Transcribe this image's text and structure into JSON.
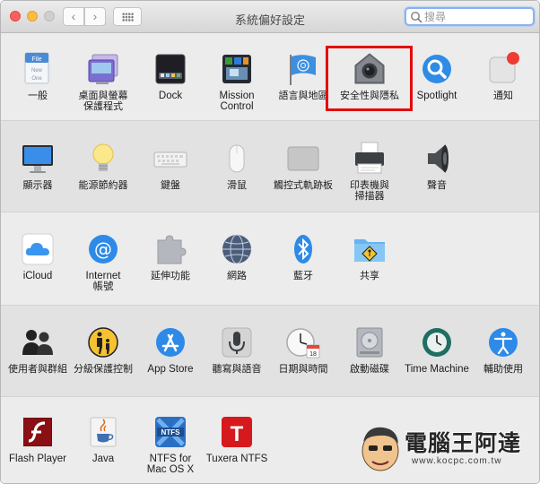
{
  "window": {
    "title": "系統偏好設定"
  },
  "search": {
    "placeholder": "搜尋",
    "value": ""
  },
  "sections": [
    {
      "items": [
        {
          "label": "一般",
          "icon": "general-file-icon"
        },
        {
          "label": "桌面與螢幕\n保護程式",
          "icon": "desktop-screensaver-icon"
        },
        {
          "label": "Dock",
          "icon": "dock-icon"
        },
        {
          "label": "Mission\nControl",
          "icon": "mission-control-icon"
        },
        {
          "label": "語言與地區",
          "icon": "un-flag-icon"
        },
        {
          "label": "安全性與隱私",
          "icon": "security-house-icon"
        },
        {
          "label": "Spotlight",
          "icon": "spotlight-magnifier-icon"
        },
        {
          "label": "通知",
          "icon": "notifications-icon"
        }
      ]
    },
    {
      "items": [
        {
          "label": "顯示器",
          "icon": "display-icon"
        },
        {
          "label": "能源節約器",
          "icon": "lightbulb-icon"
        },
        {
          "label": "鍵盤",
          "icon": "keyboard-icon"
        },
        {
          "label": "滑鼠",
          "icon": "mouse-icon"
        },
        {
          "label": "觸控式軌跡板",
          "icon": "trackpad-icon"
        },
        {
          "label": "印表機與\n掃描器",
          "icon": "printer-icon"
        },
        {
          "label": "聲音",
          "icon": "speaker-icon"
        }
      ]
    },
    {
      "items": [
        {
          "label": "iCloud",
          "icon": "icloud-icon"
        },
        {
          "label": "Internet\n帳號",
          "icon": "internet-accounts-at-icon"
        },
        {
          "label": "延伸功能",
          "icon": "extensions-puzzle-icon"
        },
        {
          "label": "網路",
          "icon": "network-globe-icon"
        },
        {
          "label": "藍牙",
          "icon": "bluetooth-icon"
        },
        {
          "label": "共享",
          "icon": "sharing-folder-icon"
        }
      ]
    },
    {
      "items": [
        {
          "label": "使用者與群組",
          "icon": "users-groups-icon"
        },
        {
          "label": "分級保護控制",
          "icon": "parental-controls-icon"
        },
        {
          "label": "App Store",
          "icon": "app-store-icon"
        },
        {
          "label": "聽寫與語音",
          "icon": "microphone-icon"
        },
        {
          "label": "日期與時間",
          "icon": "clock-calendar-icon"
        },
        {
          "label": "啟動磁碟",
          "icon": "startup-disk-icon"
        },
        {
          "label": "Time Machine",
          "icon": "time-machine-icon"
        },
        {
          "label": "輔助使用",
          "icon": "accessibility-icon"
        }
      ]
    },
    {
      "items": [
        {
          "label": "Flash Player",
          "icon": "flash-player-icon"
        },
        {
          "label": "Java",
          "icon": "java-icon"
        },
        {
          "label": "NTFS for\nMac OS X",
          "icon": "ntfs-icon"
        },
        {
          "label": "Tuxera NTFS",
          "icon": "tuxera-icon"
        }
      ]
    }
  ],
  "highlighted_item": "安全性與隱私",
  "icon_glyphs": {
    "general": "File",
    "general2": "New",
    "general3": "One",
    "calendar_day": "18",
    "ntfs": "NTFS",
    "tuxera": "T",
    "internet": "@"
  },
  "colors": {
    "highlight": "#e30b0b",
    "search_focus": "#8ab3ec"
  },
  "watermark": {
    "title": "電腦王阿達",
    "url": "www.kocpc.com.tw"
  }
}
